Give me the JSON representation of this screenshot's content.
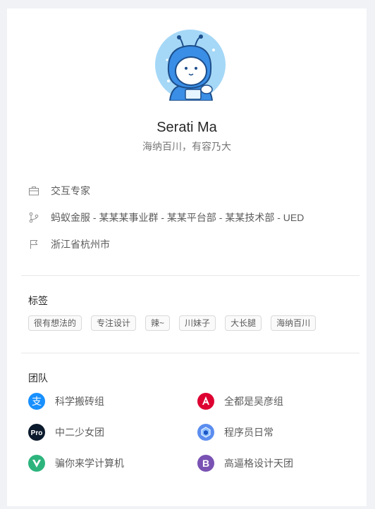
{
  "profile": {
    "name": "Serati Ma",
    "bio": "海纳百川，有容乃大"
  },
  "details": {
    "title": "交互专家",
    "org": "蚂蚁金服 - 某某某事业群 - 某某平台部 - 某某技术部 - UED",
    "location": "浙江省杭州市"
  },
  "tags_section": {
    "title": "标签",
    "items": [
      "很有想法的",
      "专注设计",
      "辣~",
      "川妹子",
      "大长腿",
      "海纳百川"
    ]
  },
  "team_section": {
    "title": "团队",
    "items": [
      {
        "name": "科学搬砖组",
        "logo": "alipay-logo",
        "color": "#1890ff"
      },
      {
        "name": "全都是吴彦组",
        "logo": "angular-logo",
        "color": "#dd0031"
      },
      {
        "name": "中二少女团",
        "logo": "pro-logo",
        "color": "#0b1a2c",
        "logo_text": "Pro"
      },
      {
        "name": "程序员日常",
        "logo": "hex-logo",
        "color": "#5b8def"
      },
      {
        "name": "骗你来学计算机",
        "logo": "vue-logo",
        "color": "#2db47d"
      },
      {
        "name": "高逼格设计天团",
        "logo": "bootstrap-logo",
        "color": "#7952b3",
        "logo_text": "B"
      }
    ]
  },
  "colors": {
    "background": "#f0f2f5",
    "card": "#ffffff",
    "avatar_bg": "#a5d8f7"
  }
}
